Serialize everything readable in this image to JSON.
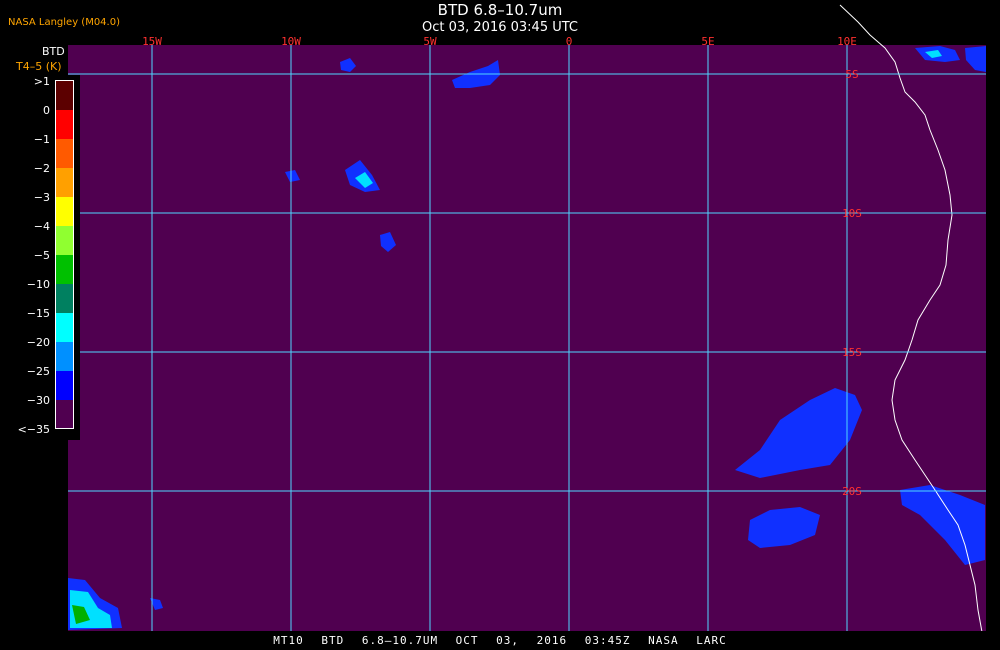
{
  "header": {
    "title": "BTD 6.8–10.7um",
    "subtitle": "Oct 03, 2016 03:45 UTC",
    "org": "NASA Langley (M04.0)"
  },
  "legend": {
    "title": "BTD",
    "unit": "T4–5 (K)",
    "items": [
      {
        "label": ">1",
        "color": "#5c0000"
      },
      {
        "label": "0",
        "color": "#ff0000"
      },
      {
        "label": "−1",
        "color": "#ff5a00"
      },
      {
        "label": "−2",
        "color": "#ffa000"
      },
      {
        "label": "−3",
        "color": "#ffff00"
      },
      {
        "label": "−4",
        "color": "#90ff30"
      },
      {
        "label": "−5",
        "color": "#00c000"
      },
      {
        "label": "−10",
        "color": "#008060"
      },
      {
        "label": "−15",
        "color": "#00ffff"
      },
      {
        "label": "−20",
        "color": "#0090ff"
      },
      {
        "label": "−25",
        "color": "#0000ff"
      },
      {
        "label": "−30",
        "color": "#500050"
      },
      {
        "label": "<−35",
        "color": "#500050"
      }
    ]
  },
  "map": {
    "background_color": "#500050",
    "grid_color": "#4fd6ff",
    "coast_color": "#ffffff",
    "lon_labels": [
      "15W",
      "10W",
      "5W",
      "0",
      "5E",
      "10E"
    ],
    "lat_labels": [
      "5S",
      "10S",
      "15S",
      "20S"
    ],
    "label_color": "#ff3030"
  },
  "footer": {
    "text": "MT10 BTD 6.8–10.7UM OCT 03, 2016 03:45Z NASA LARC"
  }
}
